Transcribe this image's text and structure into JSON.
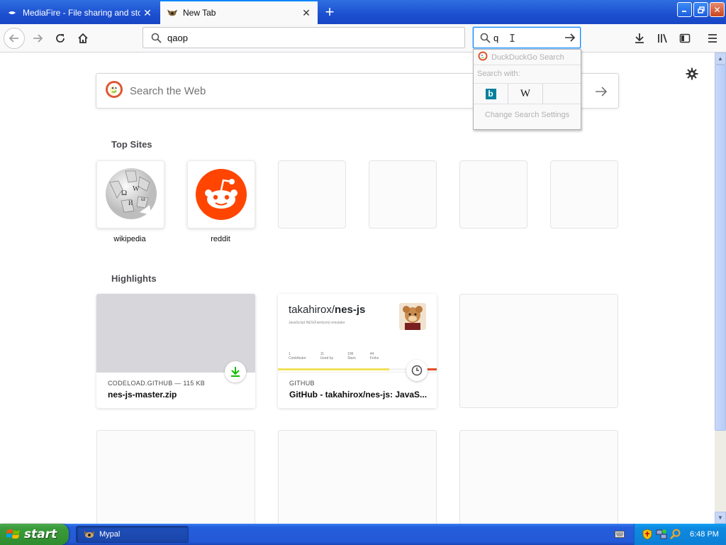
{
  "tabs": [
    {
      "title": "MediaFire - File sharing and storage",
      "icon": "mediafire-icon"
    },
    {
      "title": "New Tab",
      "icon": "mypal-icon"
    }
  ],
  "toolbar": {
    "url_value": "qaop",
    "search_value": "q"
  },
  "search_popup": {
    "engine_name": "DuckDuckGo Search",
    "search_with_label": "Search with:",
    "engines": [
      "bing-icon",
      "wikipedia-icon"
    ],
    "wiki_glyph": "W",
    "bing_glyph": "b",
    "settings_label": "Change Search Settings"
  },
  "newtab": {
    "search_placeholder": "Search the Web",
    "top_sites_title": "Top Sites",
    "top_sites": [
      {
        "label": "wikipedia",
        "icon": "wikipedia-globe-icon"
      },
      {
        "label": "reddit",
        "icon": "reddit-icon"
      }
    ],
    "highlights_title": "Highlights",
    "highlights": [
      {
        "host": "CODELOAD.GITHUB — 115 KB",
        "title": "nes-js-master.zip",
        "badge": "download-icon"
      },
      {
        "host": "GITHUB",
        "title": "GitHub - takahirox/nes-js: JavaS...",
        "badge": "clock-icon",
        "preview": {
          "owner": "takahirox/",
          "repo": "nes-js",
          "description": "JavaScript NES(Famicom) emulator",
          "stats": [
            {
              "value": "1",
              "label": "Contributor"
            },
            {
              "value": "11",
              "label": "Used by"
            },
            {
              "value": "196",
              "label": "Stars"
            },
            {
              "value": "44",
              "label": "Forks"
            }
          ]
        }
      }
    ]
  },
  "taskbar": {
    "start_label": "start",
    "task_label": "Mypal",
    "clock": "6:48 PM"
  },
  "colors": {
    "accent": "#0a84ff",
    "reddit": "#ff4500",
    "download_green": "#12bc00",
    "xp_taskbar": "#245edb"
  }
}
